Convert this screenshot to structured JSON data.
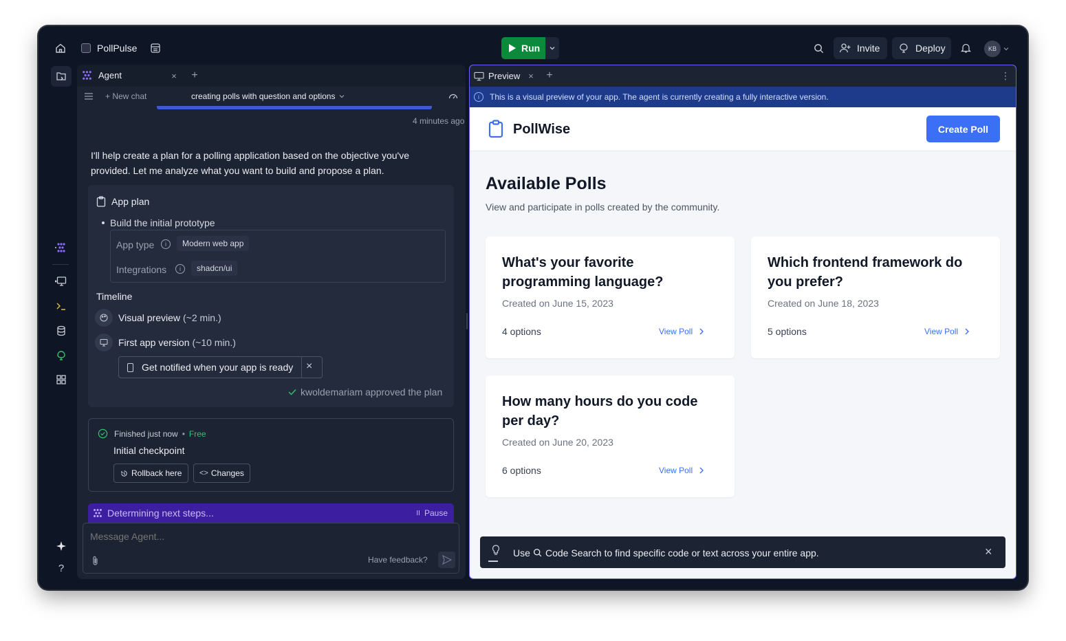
{
  "topbar": {
    "app_name": "PollPulse",
    "run_label": "Run",
    "invite_label": "Invite",
    "deploy_label": "Deploy",
    "avatar_initials": "KB"
  },
  "agent": {
    "tab_label": "Agent",
    "new_chat": "New chat",
    "chat_title": "creating polls with question and options",
    "timestamp": "4 minutes ago",
    "intro_text": "I'll help create a plan for a polling application based on the objective you've provided. Let me analyze what you want to build and propose a plan.",
    "plan": {
      "title": "App plan",
      "bullet": "Build the initial prototype",
      "app_type_label": "App type",
      "app_type_value": "Modern web app",
      "integrations_label": "Integrations",
      "integrations_value": "shadcn/ui",
      "timeline_title": "Timeline",
      "step1_name": "Visual preview",
      "step1_time": "(~2 min.)",
      "step2_name": "First app version",
      "step2_time": "(~10 min.)",
      "notify_label": "Get notified when your app is ready",
      "approved_text": "kwoldemariam approved the plan"
    },
    "checkpoint": {
      "status": "Finished just now",
      "price": "Free",
      "title": "Initial checkpoint",
      "rollback_label": "Rollback here",
      "changes_label": "Changes"
    },
    "status_bar": {
      "text": "Determining next steps...",
      "pause_label": "Pause"
    },
    "input": {
      "placeholder": "Message Agent...",
      "feedback_label": "Have feedback?"
    }
  },
  "preview": {
    "tab_label": "Preview",
    "banner": "This is a visual preview of your app. The agent is currently creating a fully interactive version.",
    "app_title": "PollWise",
    "create_button": "Create Poll",
    "heading": "Available Polls",
    "subheading": "View and participate in polls created by the community.",
    "view_poll_label": "View Poll",
    "polls": [
      {
        "title": "What's your favorite programming language?",
        "created": "Created on June 15, 2023",
        "options": "4 options"
      },
      {
        "title": "Which frontend framework do you prefer?",
        "created": "Created on June 18, 2023",
        "options": "5 options"
      },
      {
        "title": "How many hours do you code per day?",
        "created": "Created on June 20, 2023",
        "options": "6 options"
      }
    ],
    "tip": {
      "prefix": "Use",
      "suffix": "Code Search to find specific code or text across your entire app."
    }
  },
  "colors": {
    "accent_green": "#0a8a3a",
    "accent_blue": "#3b6ff5",
    "accent_purple": "#3b2a8a",
    "banner_blue": "#1e3a8a"
  }
}
